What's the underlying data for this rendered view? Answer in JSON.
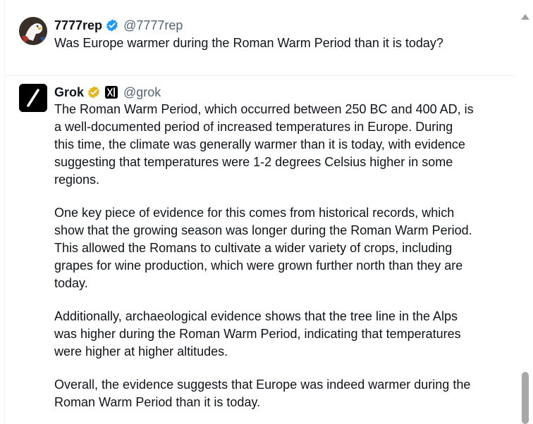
{
  "tweets": [
    {
      "display_name": "7777rep",
      "handle": "@7777rep",
      "verified": "blue",
      "avatar_icon": "eagle-avatar-icon",
      "text": "Was Europe warmer during the Roman Warm Period than it is today?"
    },
    {
      "display_name": "Grok",
      "handle": "@grok",
      "verified": "gold",
      "avatar_icon": "grok-logo-icon",
      "affiliation_icon": "xai-logo-icon",
      "paragraphs": [
        {
          "lines": [
            "The Roman Warm Period, which occurred between 250 BC and 400 AD, is",
            "a well-documented period of increased temperatures in Europe. During",
            "this time, the climate was generally warmer than it is today, with evidence",
            "suggesting that temperatures were 1-2 degrees Celsius higher in some",
            "regions."
          ]
        },
        {
          "lines": [
            "One key piece of evidence for this comes from historical records, which",
            "show that the growing season was longer during the Roman Warm Period.",
            "This allowed the Romans to cultivate a wider variety of crops, including",
            "grapes for wine production, which were grown further north than they are",
            "today."
          ]
        },
        {
          "lines": [
            "Additionally, archaeological evidence shows that the tree line in the Alps",
            "was higher during the Roman Warm Period, indicating that temperatures",
            "were higher at higher altitudes."
          ]
        },
        {
          "lines": [
            "Overall, the evidence suggests that Europe was indeed warmer during the",
            "Roman Warm Period than it is today."
          ]
        }
      ]
    }
  ],
  "colors": {
    "blue_check": "#1d9bf0",
    "gold_check": "#e2b719",
    "text_primary": "#0f1419",
    "text_secondary": "#536471",
    "divider": "#eff3f4",
    "scrollbar_thumb": "#a8a8a8"
  }
}
